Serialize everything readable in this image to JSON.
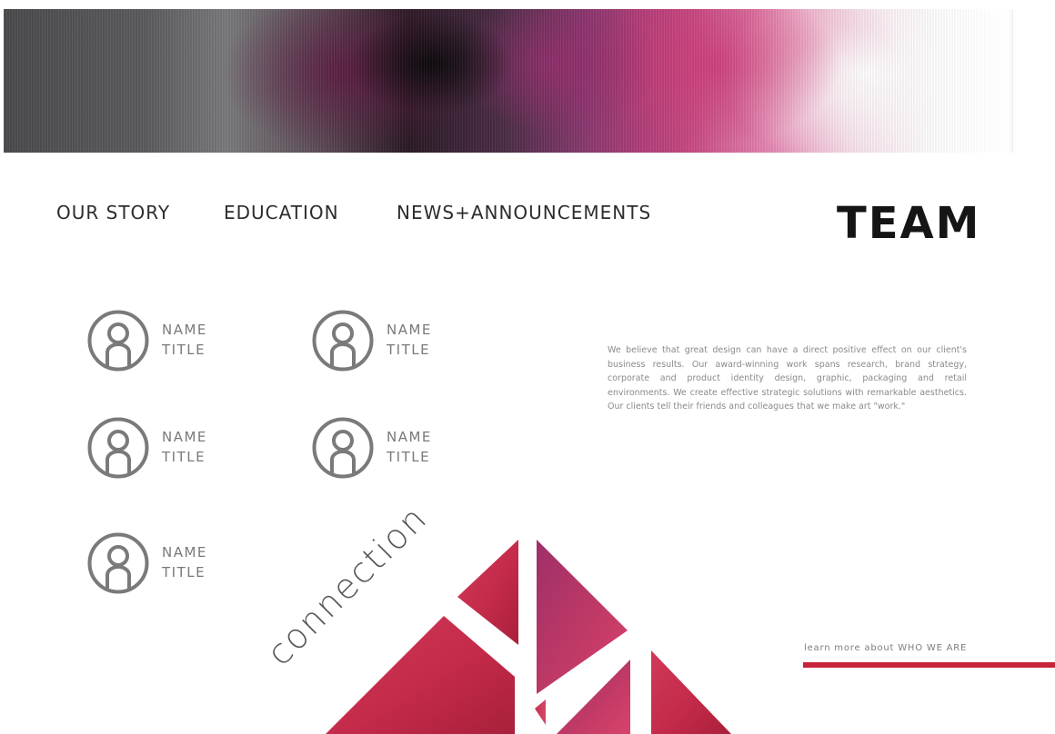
{
  "nav": {
    "items": [
      {
        "label": "OUR STORY"
      },
      {
        "label": "EDUCATION"
      },
      {
        "label": "NEWS+ANNOUNCEMENTS"
      }
    ]
  },
  "page_title": "TEAM",
  "team": [
    {
      "name": "NAME",
      "title": "TITLE"
    },
    {
      "name": "NAME",
      "title": "TITLE"
    },
    {
      "name": "NAME",
      "title": "TITLE"
    },
    {
      "name": "NAME",
      "title": "TITLE"
    },
    {
      "name": "NAME",
      "title": "TITLE"
    }
  ],
  "about_text": "We believe that great design can have a direct positive effect on our client's business results. Our award-winning work spans research, brand strategy, corporate and product identity design, graphic, packaging and retail environments. We create effective strategic solutions with remarkable aesthetics. Our clients tell their friends and colleagues that we make art \"work.\"",
  "graphic": {
    "word": "connection"
  },
  "learn_more": "learn more about WHO WE ARE",
  "colors": {
    "accent": "#c8243a",
    "avatar_stroke": "#7a7a7a",
    "triangle_red": "#c42a4a",
    "triangle_magenta": "#9e2f68"
  }
}
